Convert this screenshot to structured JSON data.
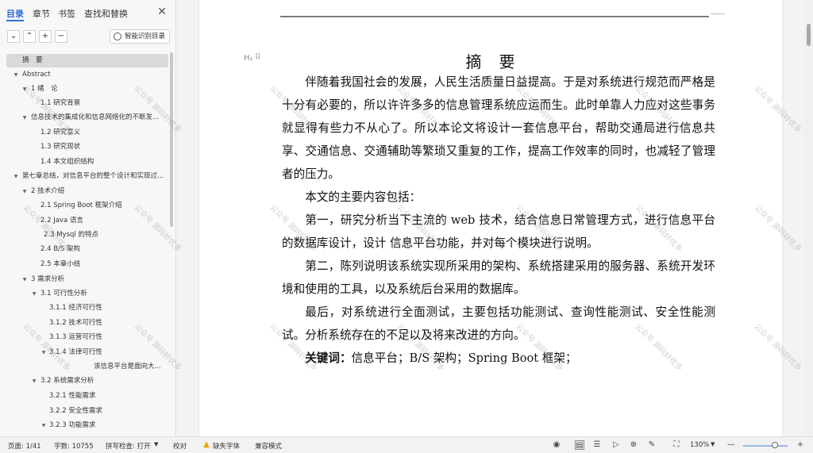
{
  "sidebar": {
    "tabs": [
      {
        "label": "目录"
      },
      {
        "label": "章节"
      },
      {
        "label": "书签"
      },
      {
        "label": "查找和替换"
      }
    ],
    "close_icon": "close-icon",
    "toolbar": {
      "collapse_icon": "chevron-down-icon",
      "expand_icon": "chevron-up-icon",
      "add_icon": "plus-icon",
      "remove_icon": "minus-icon",
      "smart_label": "智能识别目录"
    },
    "toc": [
      {
        "label": "摘　要"
      },
      {
        "label": "Abstract"
      },
      {
        "label": "1  绪　论"
      },
      {
        "label": "1.1 研究背景"
      },
      {
        "label": "信息技术的集成化和信息网络化的不断发..."
      },
      {
        "label": "1.2  研究意义"
      },
      {
        "label": "1.3 研究现状"
      },
      {
        "label": "1.4 本文组织结构"
      },
      {
        "label": "第七章总结，对信息平台的整个设计和实现过..."
      },
      {
        "label": "2  技术介绍"
      },
      {
        "label": "2.1 Spring Boot 框架介绍"
      },
      {
        "label": "2.2 Java 语言"
      },
      {
        "label": "2.3 Mysql 的特点"
      },
      {
        "label": "2.4 B/S 架构"
      },
      {
        "label": "2.5 本章小结"
      },
      {
        "label": "3 需求分析"
      },
      {
        "label": "3.1 可行性分析"
      },
      {
        "label": "3.1.1 经济可行性"
      },
      {
        "label": "3.1.2 技术可行性"
      },
      {
        "label": "3.1.3 运营可行性"
      },
      {
        "label": "3.1.4 法律可行性"
      },
      {
        "label": "该信息平台是面向大..."
      },
      {
        "label": "3.2 系统需求分析"
      },
      {
        "label": "3.2.1  性能需求"
      },
      {
        "label": "3.2.2  安全性需求"
      },
      {
        "label": "3.2.3 功能需求"
      }
    ]
  },
  "document": {
    "heading_mark": "H₁",
    "title": "摘　要",
    "paragraphs": [
      "伴随着我国社会的发展，人民生活质量日益提高。于是对系统进行规范而严格是十分有必要的，所以许许多多的信息管理系统应运而生。此时单靠人力应对这些事务就显得有些力不从心了。所以本论文将设计一套信息平台，帮助交通局进行信息共享、交通信息、交通辅助等繁琐又重复的工作，提高工作效率的同时，也减轻了管理者的压力。",
      "本文的主要内容包括：",
      "第一，研究分析当下主流的 web 技术，结合信息日常管理方式，进行信息平台的数据库设计，设计  信息平台功能，并对每个模块进行说明。",
      "第二，陈列说明该系统实现所采用的架构、系统搭建采用的服务器、系统开发环境和使用的工具，以及系统后台采用的数据库。",
      "最后，对系统进行全面测试，主要包括功能测试、查询性能测试、安全性能测试。分析系统存在的不足以及将来改进的方向。"
    ],
    "keywords_label": "关键词：",
    "keywords": "信息平台；B/S 架构；Spring Boot 框架；",
    "watermark": "公众号 源码好优多"
  },
  "statusbar": {
    "page": "页面: 1/41",
    "words": "字数: 10755",
    "spellcheck": "拼写检查: 打开",
    "proofread": "校对",
    "missing_font": "缺失字体",
    "compat": "兼容模式",
    "zoom": "130%",
    "zoom_level_percent": 130
  }
}
